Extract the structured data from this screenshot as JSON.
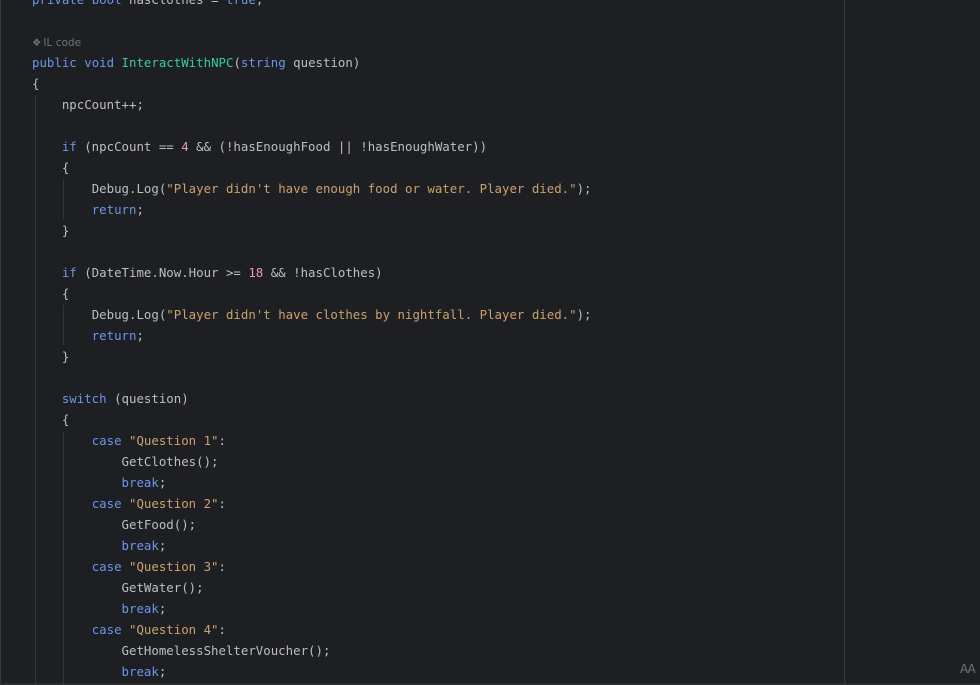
{
  "hint": {
    "icon": "lens-icon",
    "glyph": "❖",
    "label": "IL code"
  },
  "lines": {
    "l0": {
      "kw1": "private",
      "kw2": "bool",
      "name": "hasClothes",
      "eq": " = ",
      "val": "true",
      "end": ";"
    },
    "l2": {
      "kw1": "public",
      "kw2": "void",
      "fn": "InteractWithNPC",
      "p1": "(",
      "type": "string",
      "p2": " question)"
    },
    "l3": {
      "text": "{"
    },
    "l4": {
      "text": "npcCount++;"
    },
    "l6": {
      "kw": "if",
      "a": " (npcCount == ",
      "num": "4",
      "b": " && (!hasEnoughFood || !hasEnoughWater))"
    },
    "l7": {
      "text": "{"
    },
    "l8": {
      "a": "Debug.Log(",
      "str": "\"Player didn't have enough food or water. Player died.\"",
      "b": ");"
    },
    "l9": {
      "kw": "return",
      "b": ";"
    },
    "l10": {
      "text": "}"
    },
    "l12": {
      "kw": "if",
      "a": " (DateTime.Now.Hour >= ",
      "num": "18",
      "b": " && !hasClothes)"
    },
    "l13": {
      "text": "{"
    },
    "l14": {
      "a": "Debug.Log(",
      "str": "\"Player didn't have clothes by nightfall. Player died.\"",
      "b": ");"
    },
    "l15": {
      "kw": "return",
      "b": ";"
    },
    "l16": {
      "text": "}"
    },
    "l18": {
      "kw": "switch",
      "b": " (question)"
    },
    "l19": {
      "text": "{"
    },
    "l20": {
      "kw": "case",
      "str": "\"Question 1\"",
      "b": ":"
    },
    "l21": {
      "text": "GetClothes();"
    },
    "l22": {
      "kw": "break",
      "b": ";"
    },
    "l23": {
      "kw": "case",
      "str": "\"Question 2\"",
      "b": ":"
    },
    "l24": {
      "text": "GetFood();"
    },
    "l25": {
      "kw": "break",
      "b": ";"
    },
    "l26": {
      "kw": "case",
      "str": "\"Question 3\"",
      "b": ":"
    },
    "l27": {
      "text": "GetWater();"
    },
    "l28": {
      "kw": "break",
      "b": ";"
    },
    "l29": {
      "kw": "case",
      "str": "\"Question 4\"",
      "b": ":"
    },
    "l30": {
      "text": "GetHomelessShelterVoucher();"
    },
    "l31": {
      "kw": "break",
      "b": ";"
    }
  },
  "corner_icon": {
    "name": "font-size-icon",
    "glyph": "AA"
  },
  "colors": {
    "background": "#1e1f22",
    "keyword": "#6c95eb",
    "method": "#39cc9b",
    "string": "#c9a26d",
    "number": "#ed94c0",
    "identifier": "#bcbec4"
  }
}
